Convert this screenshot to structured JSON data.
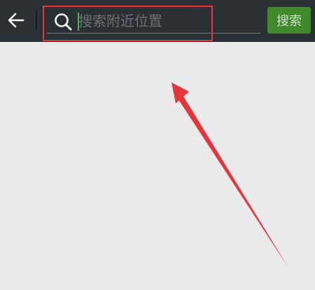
{
  "header": {
    "back_icon": "arrow-left-icon",
    "search_icon": "search-icon",
    "search_placeholder": "搜索附近位置",
    "search_value": "",
    "search_button_label": "搜索"
  },
  "annotation": {
    "highlight_color": "#e5363c"
  },
  "colors": {
    "topbar": "#2b3034",
    "background": "#ebebeb",
    "accent": "#3e8a2b"
  }
}
